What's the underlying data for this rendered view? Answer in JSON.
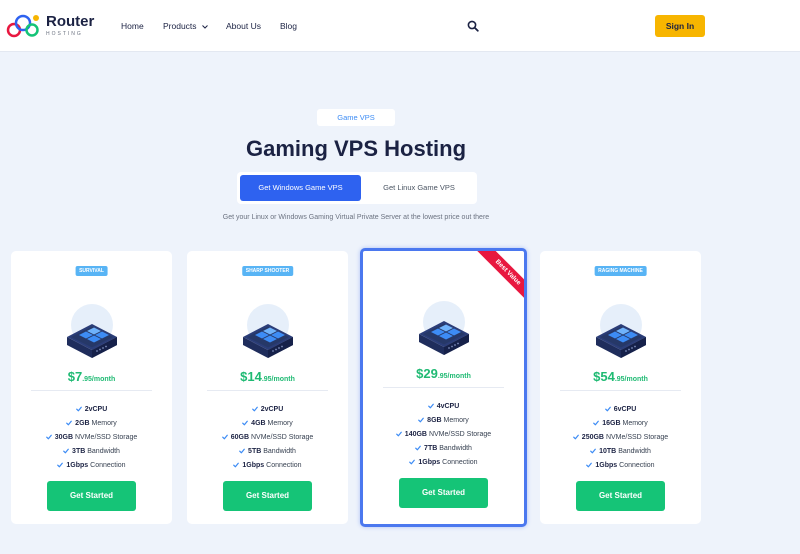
{
  "header": {
    "brand": "Router",
    "brand_sub": "HOSTING",
    "nav": [
      {
        "label": "Home"
      },
      {
        "label": "Products"
      },
      {
        "label": "About Us"
      },
      {
        "label": "Blog"
      }
    ],
    "signin_label": "Sign In"
  },
  "hero": {
    "badge": "Game VPS",
    "title": "Gaming VPS Hosting",
    "tabs": [
      {
        "label": "Get Windows Game VPS",
        "active": true
      },
      {
        "label": "Get Linux Game VPS",
        "active": false
      }
    ],
    "subtitle": "Get your Linux or Windows Gaming Virtual Private Server at the lowest price out there"
  },
  "plans": [
    {
      "badge": "SURVIVAL",
      "price_main": "$7",
      "price_suffix": ".95/month",
      "features": [
        {
          "value": "2vCPU",
          "label": ""
        },
        {
          "value": "2GB",
          "label": "Memory"
        },
        {
          "value": "30GB",
          "label": "NVMe/SSD Storage"
        },
        {
          "value": "3TB",
          "label": "Bandwidth"
        },
        {
          "value": "1Gbps",
          "label": "Connection"
        }
      ],
      "cta": "Get Started"
    },
    {
      "badge": "SHARP SHOOTER",
      "price_main": "$14",
      "price_suffix": ".95/month",
      "features": [
        {
          "value": "2vCPU",
          "label": ""
        },
        {
          "value": "4GB",
          "label": "Memory"
        },
        {
          "value": "60GB",
          "label": "NVMe/SSD Storage"
        },
        {
          "value": "5TB",
          "label": "Bandwidth"
        },
        {
          "value": "1Gbps",
          "label": "Connection"
        }
      ],
      "cta": "Get Started"
    },
    {
      "badge": "",
      "ribbon": "Best Value",
      "price_main": "$29",
      "price_suffix": ".95/month",
      "features": [
        {
          "value": "4vCPU",
          "label": ""
        },
        {
          "value": "8GB",
          "label": "Memory"
        },
        {
          "value": "140GB",
          "label": "NVMe/SSD Storage"
        },
        {
          "value": "7TB",
          "label": "Bandwidth"
        },
        {
          "value": "1Gbps",
          "label": "Connection"
        }
      ],
      "cta": "Get Started"
    },
    {
      "badge": "RAGING MACHINE",
      "price_main": "$54",
      "price_suffix": ".95/month",
      "features": [
        {
          "value": "6vCPU",
          "label": ""
        },
        {
          "value": "16GB",
          "label": "Memory"
        },
        {
          "value": "250GB",
          "label": "NVMe/SSD Storage"
        },
        {
          "value": "10TB",
          "label": "Bandwidth"
        },
        {
          "value": "1Gbps",
          "label": "Connection"
        }
      ],
      "cta": "Get Started"
    }
  ],
  "colors": {
    "accent": "#2e62f0",
    "signin": "#f7b500",
    "price": "#1fba73",
    "cta": "#15c477",
    "ribbon": "#e8173f",
    "badge": "#58b4f5"
  },
  "icons": {
    "search": "search-icon",
    "products_dropdown": "chevron-down-icon",
    "feature": "check-icon",
    "plan_image": "server-icon"
  }
}
